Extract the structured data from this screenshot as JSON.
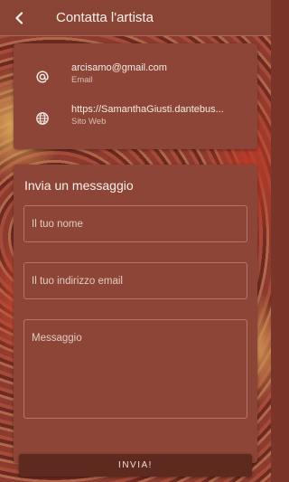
{
  "appbar": {
    "title": "Contatta l'artista",
    "back_icon": "chevron-left-icon"
  },
  "contact": {
    "items": [
      {
        "icon": "at-icon",
        "value": "arcisamo@gmail.com",
        "label": "Email"
      },
      {
        "icon": "globe-icon",
        "value": "https://SamanthaGiusti.dantebus...",
        "label": "Sito Web"
      }
    ]
  },
  "message_form": {
    "title": "Invia un messaggio",
    "name_placeholder": "Il tuo nome",
    "email_placeholder": "Il tuo indirizzo email",
    "message_placeholder": "Messaggio",
    "submit_label": "INVIA!"
  },
  "colors": {
    "appbar": "#8a4436",
    "card": "#8c4536",
    "button": "#5e2a20"
  }
}
